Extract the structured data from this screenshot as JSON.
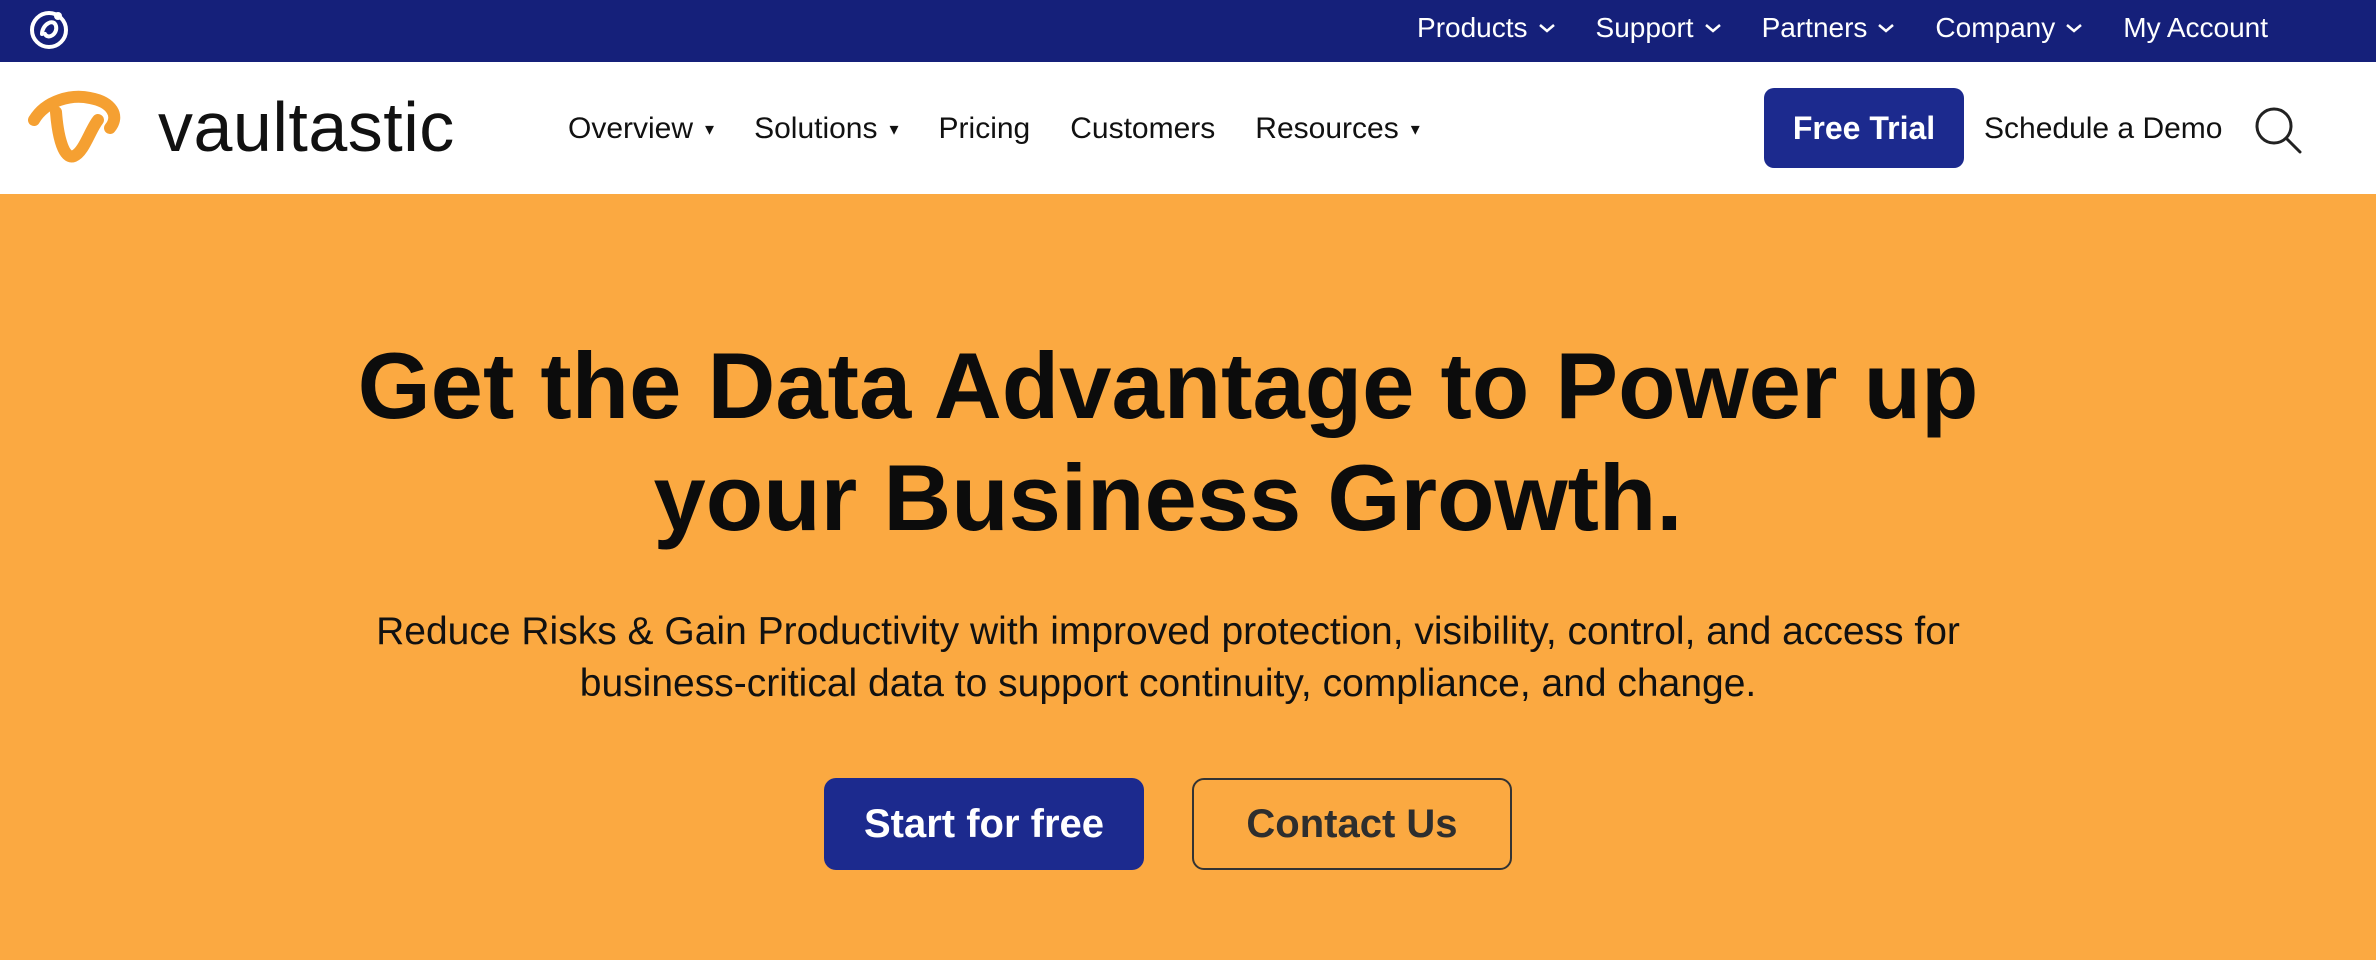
{
  "topbar": {
    "logo_icon": "vaultastic-mini-logo-icon",
    "items": [
      {
        "label": "Products",
        "icon": "chevron-down-icon"
      },
      {
        "label": "Support",
        "icon": "chevron-down-icon"
      },
      {
        "label": "Partners",
        "icon": "chevron-down-icon"
      },
      {
        "label": "Company",
        "icon": "chevron-down-icon"
      },
      {
        "label": "My Account"
      }
    ]
  },
  "header": {
    "brand_name": "vaultastic",
    "nav": [
      {
        "label": "Overview",
        "caret": "▾"
      },
      {
        "label": "Solutions",
        "caret": "▾"
      },
      {
        "label": "Pricing"
      },
      {
        "label": "Customers"
      },
      {
        "label": "Resources",
        "caret": "▾"
      }
    ],
    "free_trial_label": "Free Trial",
    "schedule_demo_label": "Schedule a Demo",
    "search_icon": "search-icon"
  },
  "hero": {
    "title": "Get the Data Advantage to Power up your Business Growth.",
    "subtitle": "Reduce Risks & Gain Productivity with improved protection, visibility, control, and access for business-critical data to support continuity, compliance, and change.",
    "primary_button": "Start for free",
    "secondary_button": "Contact Us"
  },
  "colors": {
    "topbar_bg": "#15207a",
    "hero_bg": "#fba941",
    "primary_button_bg": "#1c2a8e",
    "brand_orange": "#f5a032"
  }
}
